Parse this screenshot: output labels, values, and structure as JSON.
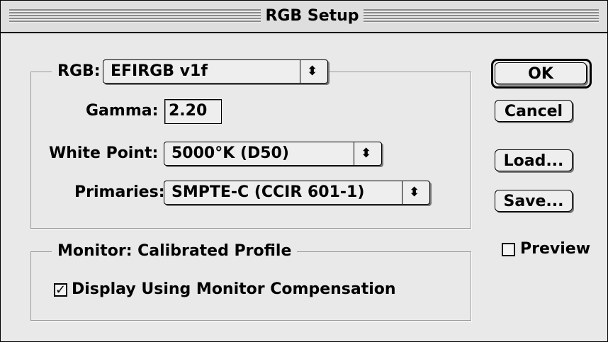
{
  "window": {
    "title": "RGB Setup"
  },
  "rgb_group": {
    "label": "RGB:",
    "rgb_popup": {
      "value": "EFIRGB v1f"
    },
    "gamma": {
      "label": "Gamma:",
      "value": "2.20"
    },
    "white_point": {
      "label": "White Point:",
      "value": "5000°K (D50)"
    },
    "primaries": {
      "label": "Primaries:",
      "value": "SMPTE-C (CCIR 601-1)"
    }
  },
  "monitor_group": {
    "label": "Monitor:  Calibrated Profile",
    "compensation": {
      "label": "Display Using Monitor Compensation",
      "checked": true
    }
  },
  "buttons": {
    "ok": "OK",
    "cancel": "Cancel",
    "load": "Load...",
    "save": "Save..."
  },
  "preview": {
    "label": "Preview",
    "checked": false
  },
  "icons": {
    "popup_arrows": "up-down-arrows-icon",
    "check_mark": "check-mark-icon"
  }
}
